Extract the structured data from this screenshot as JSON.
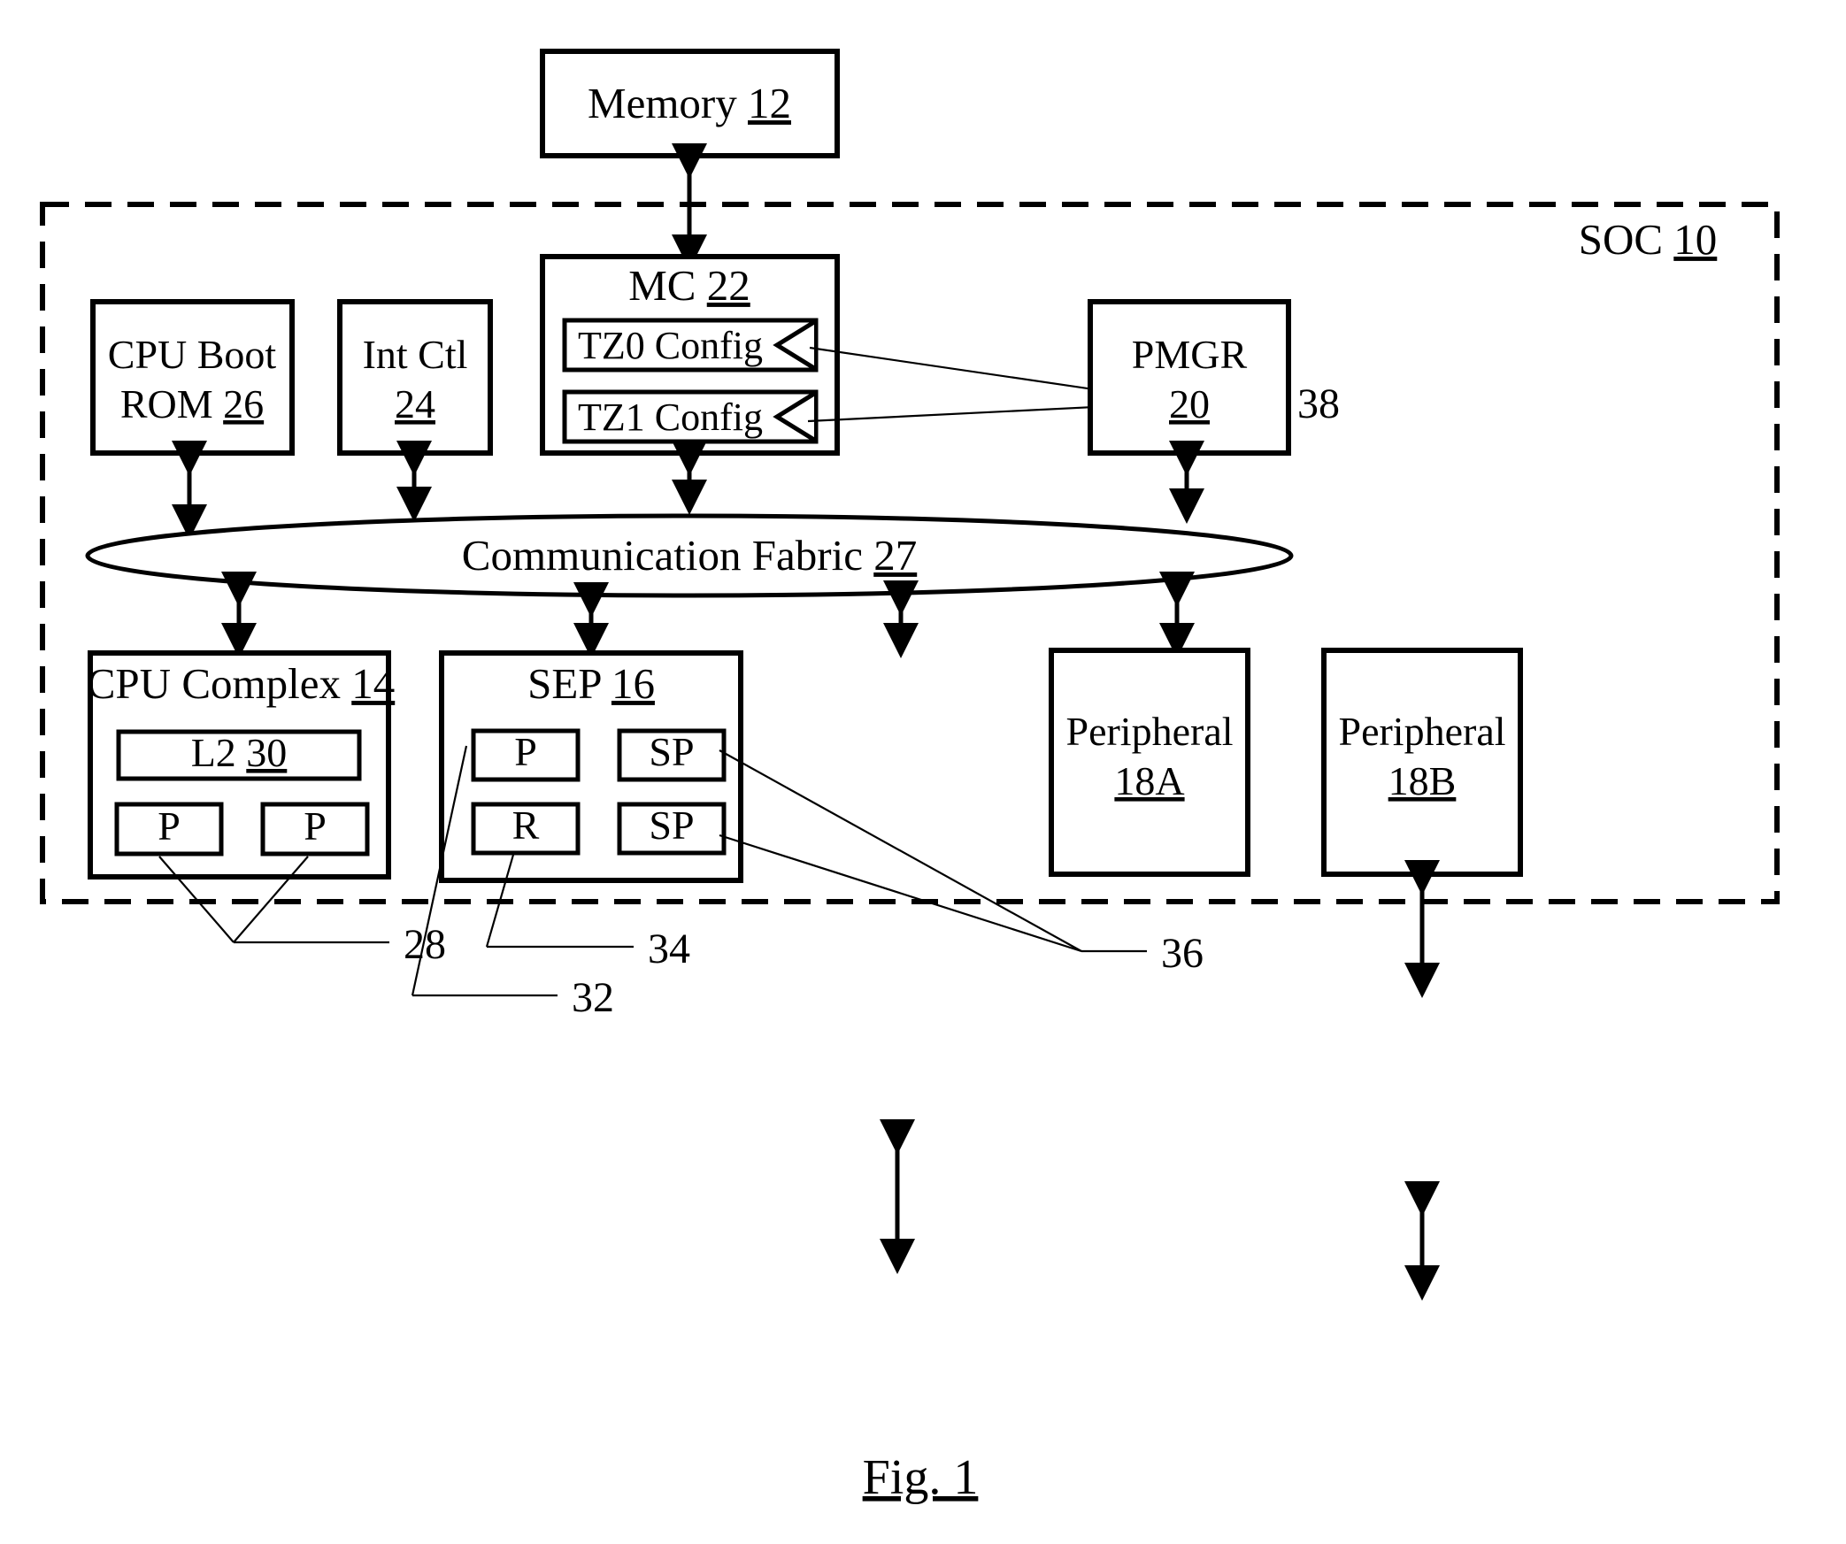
{
  "figure": {
    "caption": "Fig. 1",
    "caption_underlined": true
  },
  "boundary": {
    "label_text": "SOC",
    "label_ref": "10",
    "style": "dashed",
    "name": "soc-boundary"
  },
  "blocks": [
    {
      "id": "memory",
      "label": "Memory",
      "ref": "12",
      "lines": [
        "Memory 12"
      ]
    },
    {
      "id": "mc",
      "label": "MC",
      "ref": "22",
      "lines": [
        "MC 22"
      ]
    },
    {
      "id": "cpu-boot-rom",
      "label": "CPU Boot ROM",
      "ref": "26",
      "lines": [
        "CPU Boot",
        "ROM 26"
      ]
    },
    {
      "id": "int-ctl",
      "label": "Int Ctl",
      "ref": "24",
      "lines": [
        "Int Ctl",
        "24"
      ]
    },
    {
      "id": "pmgr",
      "label": "PMGR",
      "ref": "20",
      "lines": [
        "PMGR",
        "20"
      ]
    },
    {
      "id": "comm-fabric",
      "label": "Communication Fabric",
      "ref": "27",
      "lines": [
        "Communication Fabric 27"
      ]
    },
    {
      "id": "cpu-complex",
      "label": "CPU Complex",
      "ref": "14",
      "lines": [
        "CPU Complex 14"
      ]
    },
    {
      "id": "sep",
      "label": "SEP",
      "ref": "16",
      "lines": [
        "SEP 16"
      ]
    },
    {
      "id": "peripheral-a",
      "label": "Peripheral",
      "ref": "18A",
      "lines": [
        "Peripheral",
        "18A"
      ]
    },
    {
      "id": "peripheral-b",
      "label": "Peripheral",
      "ref": "18B",
      "lines": [
        "Peripheral",
        "18B"
      ]
    }
  ],
  "mc_sub_blocks": [
    {
      "id": "tz0-config",
      "label": "TZ0 Config"
    },
    {
      "id": "tz1-config",
      "label": "TZ1 Config"
    }
  ],
  "cpu_complex_sub_blocks": [
    {
      "id": "l2-cache",
      "label": "L2",
      "ref": "30",
      "text": "L2 30"
    },
    {
      "id": "cpu-p-left",
      "label": "P",
      "text": "P"
    },
    {
      "id": "cpu-p-right",
      "label": "P",
      "text": "P"
    }
  ],
  "sep_sub_blocks": [
    {
      "id": "sep-p",
      "label": "P",
      "text": "P"
    },
    {
      "id": "sep-r",
      "label": "R",
      "text": "R"
    },
    {
      "id": "sep-sp-top",
      "label": "SP",
      "text": "SP"
    },
    {
      "id": "sep-sp-bottom",
      "label": "SP",
      "text": "SP"
    }
  ],
  "callouts": [
    {
      "id": "callout-28",
      "text": "28",
      "points_to": "cpu-complex P processors"
    },
    {
      "id": "callout-32",
      "text": "32",
      "points_to": "sep P processor"
    },
    {
      "id": "callout-34",
      "text": "34",
      "points_to": "sep R block"
    },
    {
      "id": "callout-36",
      "text": "36",
      "points_to": "sep SP blocks"
    },
    {
      "id": "callout-38",
      "text": "38",
      "points_to": "MC TZ config registers"
    }
  ],
  "labels": {
    "memory": "Memory",
    "memory_ref": "12",
    "mc": "MC",
    "mc_ref": "22",
    "tz0": "TZ0 Config",
    "tz1": "TZ1 Config",
    "cpu_boot_line1": "CPU Boot",
    "cpu_boot_line2": "ROM",
    "cpu_boot_ref": "26",
    "int_ctl_line1": "Int Ctl",
    "int_ctl_ref": "24",
    "pmgr_line1": "PMGR",
    "pmgr_ref": "20",
    "fabric": "Communication Fabric",
    "fabric_ref": "27",
    "cpu_complex": "CPU Complex",
    "cpu_complex_ref": "14",
    "l2": "L2",
    "l2_ref": "30",
    "p": "P",
    "r": "R",
    "sp": "SP",
    "sep": "SEP",
    "sep_ref": "16",
    "peripheral": "Peripheral",
    "peripheral_a_ref": "18A",
    "peripheral_b_ref": "18B",
    "soc": "SOC",
    "soc_ref": "10",
    "c28": "28",
    "c32": "32",
    "c34": "34",
    "c36": "36",
    "c38": "38",
    "fig": "Fig. 1"
  },
  "colors": {
    "stroke": "#000000",
    "fill": "#ffffff",
    "background": "#ffffff"
  }
}
